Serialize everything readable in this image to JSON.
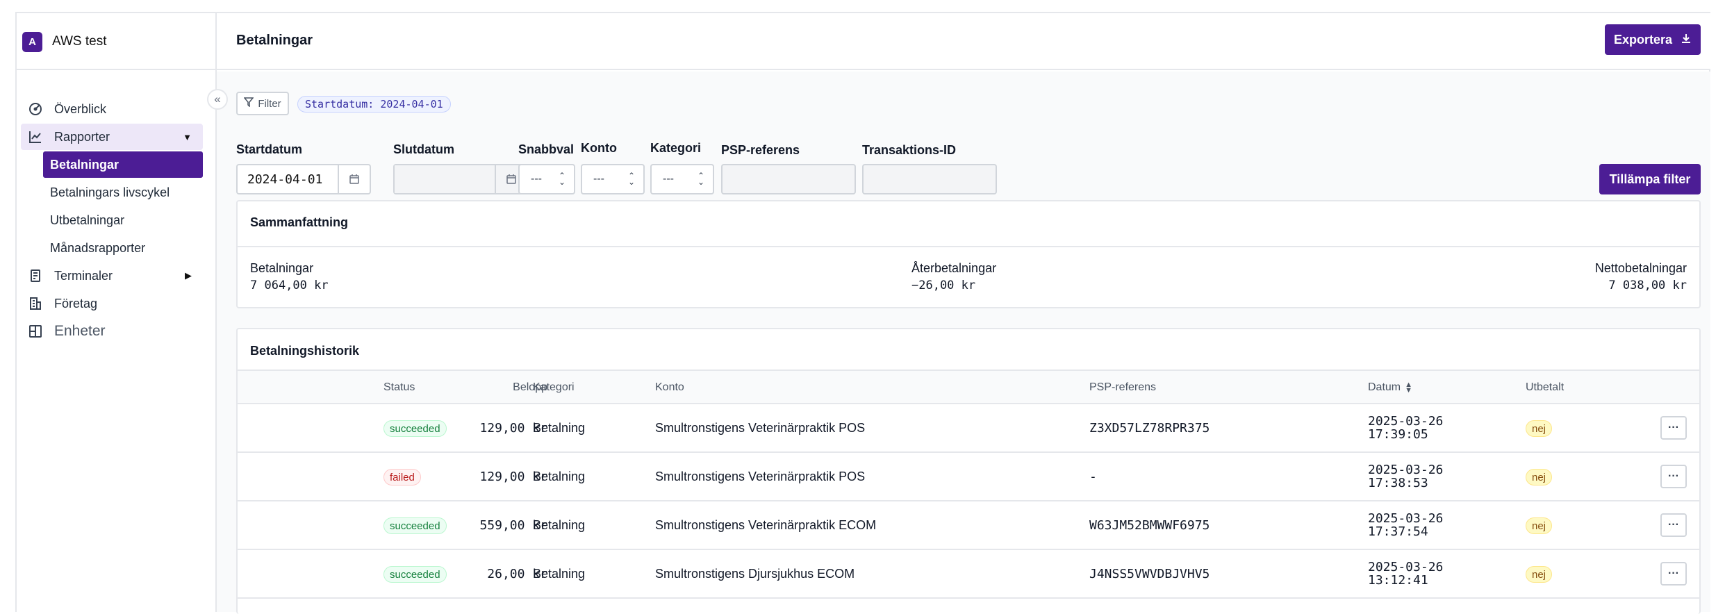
{
  "app": {
    "logo_letter": "A",
    "name": "AWS test"
  },
  "sidebar": {
    "items": [
      {
        "label": "Överblick",
        "icon": "gauge-icon"
      },
      {
        "label": "Rapporter",
        "icon": "chart-line-icon"
      },
      {
        "label": "Terminaler",
        "icon": "terminal-device-icon"
      },
      {
        "label": "Företag",
        "icon": "building-icon"
      },
      {
        "label": "Enheter",
        "icon": "device-icon"
      }
    ],
    "sub_items": [
      {
        "label": "Betalningar"
      },
      {
        "label": "Betalningars livscykel"
      },
      {
        "label": "Utbetalningar"
      },
      {
        "label": "Månadsrapporter"
      }
    ]
  },
  "header": {
    "title": "Betalningar",
    "export_label": "Exportera"
  },
  "filters": {
    "filter_button": "Filter",
    "active_chip": "Startdatum: 2024-04-01",
    "start_label": "Startdatum",
    "start_value": "2024-04-01",
    "end_label": "Slutdatum",
    "end_value": "",
    "quick_label": "Snabbval",
    "quick_value": "---",
    "account_label": "Konto",
    "account_value": "---",
    "category_label": "Kategori",
    "category_value": "---",
    "psp_label": "PSP-referens",
    "psp_value": "",
    "txid_label": "Transaktions-ID",
    "txid_value": "",
    "apply_label": "Tillämpa filter"
  },
  "summary": {
    "title": "Sammanfattning",
    "payments_label": "Betalningar",
    "payments_value": "7 064,00 kr",
    "refunds_label": "Återbetalningar",
    "refunds_value": "−26,00 kr",
    "net_label": "Nettobetalningar",
    "net_value": "7 038,00 kr"
  },
  "history": {
    "title": "Betalningshistorik",
    "columns": {
      "amount": "Belopp",
      "status": "Status",
      "category": "Kategori",
      "account": "Konto",
      "psp": "PSP-referens",
      "date": "Datum",
      "paid_out": "Utbetalt"
    },
    "rows": [
      {
        "amount": "129,00 kr",
        "status": "succeeded",
        "category": "Betalning",
        "account": "Smultronstigens Veterinärpraktik POS",
        "psp": "Z3XD57LZ78RPR375",
        "date": "2025-03-26",
        "time": "17:39:05",
        "paid_out": "nej"
      },
      {
        "amount": "129,00 kr",
        "status": "failed",
        "category": "Betalning",
        "account": "Smultronstigens Veterinärpraktik POS",
        "psp": "-",
        "date": "2025-03-26",
        "time": "17:38:53",
        "paid_out": "nej"
      },
      {
        "amount": "559,00 kr",
        "status": "succeeded",
        "category": "Betalning",
        "account": "Smultronstigens Veterinärpraktik ECOM",
        "psp": "W63JM52BMWWF6975",
        "date": "2025-03-26",
        "time": "17:37:54",
        "paid_out": "nej"
      },
      {
        "amount": "26,00 kr",
        "status": "succeeded",
        "category": "Betalning",
        "account": "Smultronstigens Djursjukhus ECOM",
        "psp": "J4NSS5VWVDBJVHV5",
        "date": "2025-03-26",
        "time": "13:12:41",
        "paid_out": "nej"
      }
    ]
  },
  "colors": {
    "primary": "#4c1d95",
    "active_parent_bg": "#ede7f8"
  }
}
